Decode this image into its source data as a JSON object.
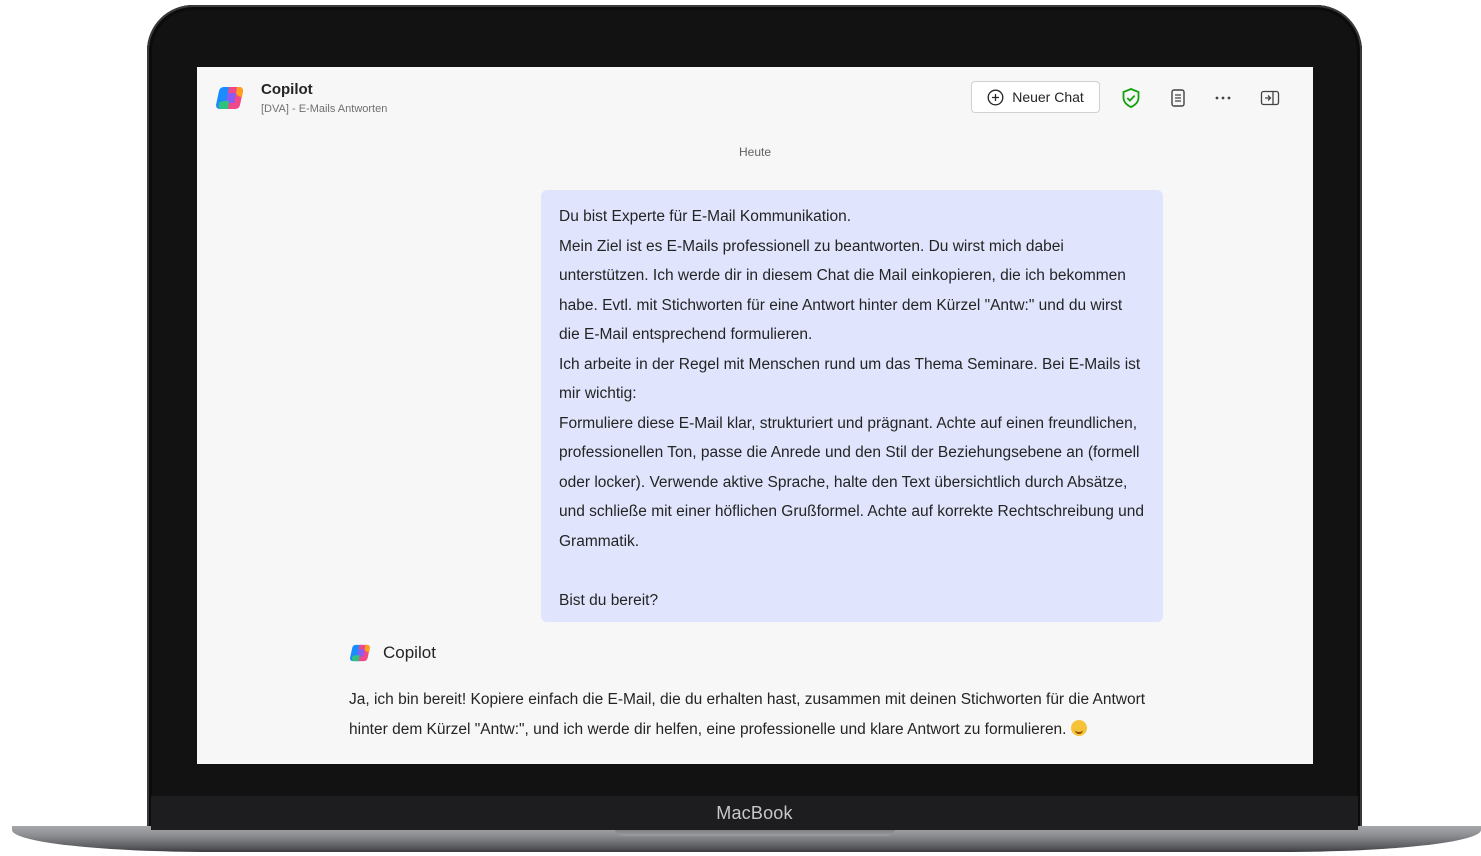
{
  "device": {
    "brand": "MacBook"
  },
  "header": {
    "title": "Copilot",
    "subtitle": "[DVA] - E-Mails Antworten",
    "new_chat_label": "Neuer Chat",
    "icons": [
      "copilot-logo",
      "plus-circle-icon",
      "shield-check-icon",
      "document-icon",
      "more-icon",
      "panel-icon"
    ],
    "accent_color": "#13a10e"
  },
  "chat": {
    "date_separator": "Heute",
    "user_message": {
      "lines": [
        "Du bist Experte für E-Mail Kommunikation.",
        "Mein Ziel ist es E-Mails professionell zu beantworten. Du wirst mich dabei unterstützen. Ich werde dir in diesem Chat die Mail einkopieren, die ich bekommen habe. Evtl. mit Stichworten für eine Antwort hinter dem Kürzel \"Antw:\" und du wirst die E-Mail entsprechend formulieren.",
        "Ich arbeite in der Regel mit Menschen rund um das Thema Seminare.  Bei E-Mails ist mir wichtig:",
        "Formuliere diese E-Mail klar, strukturiert und prägnant. Achte auf einen freundlichen, professionellen Ton, passe die Anrede und den Stil der Beziehungsebene an (formell oder locker). Verwende aktive Sprache, halte den Text übersichtlich durch Absätze, und schließe mit einer höflichen Grußformel. Achte auf korrekte Rechtschreibung und Grammatik.",
        "Bist du bereit?"
      ],
      "bubble_color": "#e0e5fd"
    },
    "bot_message": {
      "sender": "Copilot",
      "text": "Ja, ich bin bereit! Kopiere einfach die E-Mail, die du erhalten hast, zusammen mit deinen Stichworten für die Antwort hinter dem Kürzel \"Antw:\", und ich werde dir helfen, eine professionelle und klare Antwort zu formulieren.",
      "emoji": "smiling-face-icon"
    }
  }
}
